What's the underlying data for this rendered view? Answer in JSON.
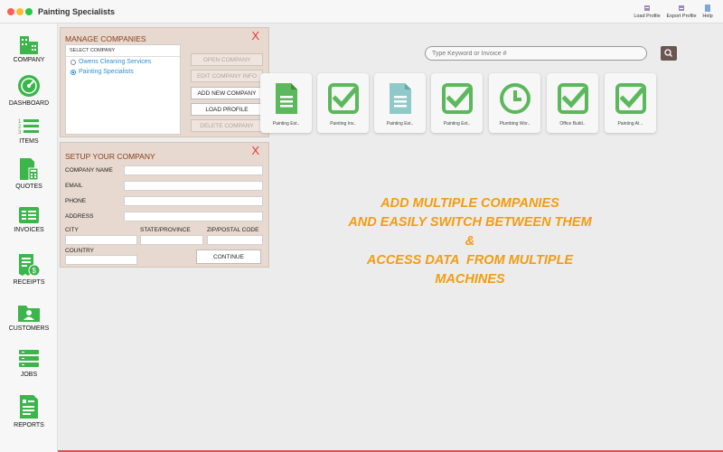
{
  "window": {
    "title": "Painting Specialists"
  },
  "toolbar": {
    "load_profile": "Load Profile",
    "export_profile": "Export Profile",
    "help": "Help"
  },
  "sidebar": {
    "items": [
      {
        "label": "COMPANY",
        "icon": "building-icon"
      },
      {
        "label": "DASHBOARD",
        "icon": "gauge-icon"
      },
      {
        "label": "ITEMS",
        "icon": "numbered-list-icon"
      },
      {
        "label": "QUOTES",
        "icon": "quote-calculator-icon"
      },
      {
        "label": "INVOICES",
        "icon": "invoice-icon"
      },
      {
        "label": "RECEIPTS",
        "icon": "receipt-icon"
      },
      {
        "label": "CUSTOMERS",
        "icon": "customer-folder-icon"
      },
      {
        "label": "JOBS",
        "icon": "jobs-stack-icon"
      },
      {
        "label": "REPORTS",
        "icon": "report-document-icon"
      }
    ]
  },
  "manage": {
    "title": "MANAGE COMPANIES",
    "close": "X",
    "list_header": "SELECT COMPANY",
    "companies": [
      {
        "name": "Owens Cleaning Services",
        "selected": false
      },
      {
        "name": "Painting Specialists",
        "selected": true
      }
    ],
    "buttons": {
      "open": "OPEN COMPANY",
      "edit": "EDIT COMPANY INFO",
      "add": "ADD NEW COMPANY",
      "load": "LOAD PROFILE",
      "delete": "DELETE COMPANY"
    }
  },
  "setup": {
    "title": "SETUP YOUR COMPANY",
    "close": "X",
    "labels": {
      "company_name": "COMPANY NAME",
      "email": "EMAIL",
      "phone": "PHONE",
      "address": "ADDRESS",
      "city": "CITY",
      "state": "STATE/PROVINCE",
      "zip": "ZIP/POSTAL CODE",
      "country": "COUNTRY"
    },
    "values": {
      "company_name": "",
      "email": "",
      "phone": "",
      "address": "",
      "city": "",
      "state": "",
      "zip": "",
      "country": ""
    },
    "continue": "CONTINUE"
  },
  "search": {
    "placeholder": "Type Keyword or Invoice #"
  },
  "tiles": [
    {
      "label": "Painting Est..",
      "icon": "document-icon",
      "color": "#5cb85c"
    },
    {
      "label": "Painting Inv..",
      "icon": "checkmark-icon",
      "color": "#5cb85c"
    },
    {
      "label": "Painting Est..",
      "icon": "document-icon",
      "color": "#8fc9c9"
    },
    {
      "label": "Painting Est..",
      "icon": "checkmark-icon",
      "color": "#5cb85c"
    },
    {
      "label": "Plumbing Wor..",
      "icon": "clock-icon",
      "color": "#5cb85c"
    },
    {
      "label": "Office Build..",
      "icon": "checkmark-icon",
      "color": "#5cb85c"
    },
    {
      "label": "Painting At ..",
      "icon": "checkmark-icon",
      "color": "#5cb85c"
    }
  ],
  "promo": {
    "line1": "ADD MULTIPLE COMPANIES",
    "line2": "AND EASILY SWITCH BETWEEN THEM",
    "line3": "&",
    "line4": "ACCESS DATA  FROM MULTIPLE",
    "line5": "MACHINES"
  },
  "colors": {
    "accent_green": "#5cb85c",
    "promo_orange": "#f39c12",
    "panel_bg": "#e7d9cf",
    "close_red": "#e53935"
  }
}
